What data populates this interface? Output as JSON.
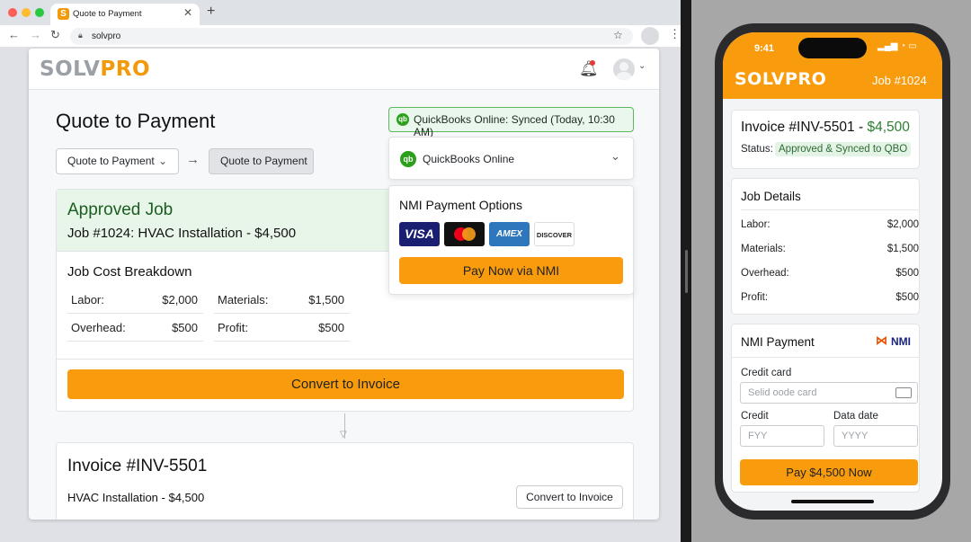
{
  "browser": {
    "tab_title": "Quote to Payment",
    "tab_icon": "S",
    "url": "solvpro"
  },
  "app": {
    "logo_part1": "SOLV",
    "logo_part2": "PRO",
    "page_title": "Quote to Payment",
    "qb_status": "QuickBooks Online: Synced (Today, 10:30 AM)",
    "breadcrumb": {
      "step1": "Quote to Payment",
      "step2": "Quote to Payment"
    },
    "job": {
      "status_title": "Approved Job",
      "subtitle": "Job #1024: HVAC Installation - $4,500",
      "breakdown_title": "Job Cost Breakdown",
      "items": [
        {
          "label": "Labor:",
          "value": "$2,000"
        },
        {
          "label": "Materials:",
          "value": "$1,500"
        },
        {
          "label": "Overhead:",
          "value": "$500"
        },
        {
          "label": "Profit:",
          "value": "$500"
        }
      ],
      "cta": "Convert to Invoice"
    },
    "invoice": {
      "title": "Invoice #INV-5501",
      "subtitle": "HVAC Installation - $4,500",
      "button": "Convert to Invoice"
    },
    "dropdown": {
      "icon_text": "qb",
      "selected": "QuickBooks Online"
    },
    "nmi": {
      "title": "NMI Payment Options",
      "cards": [
        "VISA",
        "Mastercard",
        "AMEX",
        "DISCOVER"
      ],
      "pay_button": "Pay Now via NMI"
    }
  },
  "phone": {
    "time": "9:41",
    "logo_part1": "SOLV",
    "logo_part2": "PRO",
    "job_label": "Job #1024",
    "invoice_prefix": "Invoice #INV-5501 - ",
    "invoice_amount": "$4,500",
    "status_label": "Status:",
    "status_value": "Approved & Synced to QBO",
    "details_title": "Job Details",
    "details": [
      {
        "label": "Labor:",
        "value": "$2,000"
      },
      {
        "label": "Materials:",
        "value": "$1,500"
      },
      {
        "label": "Overhead:",
        "value": "$500"
      },
      {
        "label": "Profit:",
        "value": "$500"
      }
    ],
    "payment_title": "NMI Payment",
    "nmi_logo": "NMI",
    "credit_card_label": "Credit card",
    "credit_card_placeholder": "Selid oode card",
    "credit_label": "Credit",
    "credit_placeholder": "FYY",
    "date_label": "Data date",
    "date_placeholder": "YYYY",
    "pay_button": "Pay $4,500 Now"
  },
  "colors": {
    "accent": "#f89c0e",
    "success_bg": "#e8f5e9",
    "success_text": "#1b5e20",
    "qb_green": "#2ca01c"
  }
}
